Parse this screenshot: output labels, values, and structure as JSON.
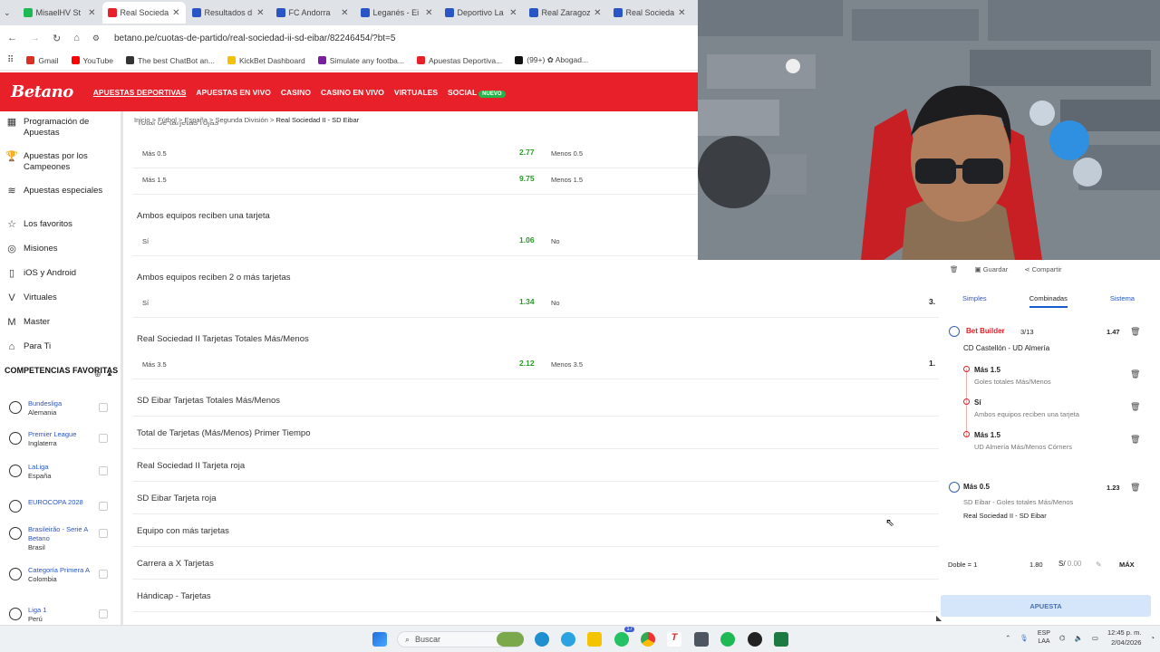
{
  "browser": {
    "tabs": [
      {
        "label": "MisaelHV St",
        "color": "#1db954",
        "active": false
      },
      {
        "label": "Real Socieda",
        "color": "#e8202a",
        "active": true
      },
      {
        "label": "Resultados d",
        "color": "#2a55c4",
        "active": false
      },
      {
        "label": "FC Andorra",
        "color": "#2a55c4",
        "active": false
      },
      {
        "label": "Leganés - Ei",
        "color": "#2a55c4",
        "active": false
      },
      {
        "label": "Deportivo La",
        "color": "#2a55c4",
        "active": false
      },
      {
        "label": "Real Zaragoz",
        "color": "#2a55c4",
        "active": false
      },
      {
        "label": "Real Socieda",
        "color": "#2a55c4",
        "active": false
      }
    ],
    "url": "betano.pe/cuotas-de-partido/real-sociedad-ii-sd-eibar/82246454/?bt=5",
    "bookmarks": [
      {
        "label": "Gmail",
        "color": "#d93025"
      },
      {
        "label": "YouTube",
        "color": "#ff0000"
      },
      {
        "label": "The best ChatBot an...",
        "color": "#333333"
      },
      {
        "label": "KickBet Dashboard",
        "color": "#f2c200"
      },
      {
        "label": "Simulate any footba...",
        "color": "#7b1fa2"
      },
      {
        "label": "Apuestas Deportiva...",
        "color": "#e8202a"
      },
      {
        "label": "(99+) ✿ Abogad...",
        "color": "#111111"
      }
    ]
  },
  "header": {
    "logo": "Betano",
    "nav": [
      "APUESTAS DEPORTIVAS",
      "APUESTAS EN VIVO",
      "CASINO",
      "CASINO EN VIVO",
      "VIRTUALES",
      "SOCIAL"
    ],
    "nav_badge": "NUEVO"
  },
  "sidebar": {
    "items": [
      {
        "label": "Programación de Apuestas",
        "icon": "calendar-icon"
      },
      {
        "label": "Apuestas por los Campeones",
        "icon": "trophy-icon"
      },
      {
        "label": "Apuestas especiales",
        "icon": "special-icon"
      },
      {
        "label": "Los favoritos",
        "icon": "star-icon"
      },
      {
        "label": "Misiones",
        "icon": "target-icon"
      },
      {
        "label": "iOS y Android",
        "icon": "phone-icon"
      },
      {
        "label": "Virtuales",
        "icon": "virtual-icon"
      },
      {
        "label": "Master",
        "icon": "master-icon"
      },
      {
        "label": "Para Ti",
        "icon": "foryou-icon"
      }
    ],
    "competitions_header": "COMPETENCIAS FAVORITAS",
    "competitions": [
      {
        "name": "Bundesliga",
        "country": "Alemania"
      },
      {
        "name": "Premier League",
        "country": "Inglaterra"
      },
      {
        "name": "LaLiga",
        "country": "España"
      },
      {
        "name": "EUROCOPA 2028",
        "country": ""
      },
      {
        "name": "Brasileirão - Serie A Betano",
        "country": "Brasil"
      },
      {
        "name": "Categoría Primera A",
        "country": "Colombia"
      },
      {
        "name": "Liga 1",
        "country": "Perú"
      }
    ]
  },
  "main": {
    "breadcrumb": [
      "Inicio",
      "Fútbol",
      "España",
      "Segunda División",
      "Real Sociedad II - SD Eibar"
    ],
    "cut_title": "Total de tarjetas rojas",
    "markets": [
      {
        "title": "",
        "rows": [
          {
            "left": "Más 0.5",
            "odd": "2.77",
            "right": "Menos 0.5"
          },
          {
            "left": "Más 1.5",
            "odd": "9.75",
            "right": "Menos 1.5"
          }
        ]
      },
      {
        "title": "Ambos equipos reciben una tarjeta",
        "rows": [
          {
            "left": "Sí",
            "odd": "1.06",
            "right": "No"
          }
        ]
      },
      {
        "title": "Ambos equipos reciben 2 o más tarjetas",
        "rows": [
          {
            "left": "Sí",
            "odd": "1.34",
            "right": "No",
            "right_odd_cut": "3."
          }
        ]
      },
      {
        "title": "Real Sociedad II Tarjetas Totales Más/Menos",
        "rows": [
          {
            "left": "Más 3.5",
            "odd": "2.12",
            "right": "Menos 3.5",
            "right_odd_cut": "1."
          }
        ]
      }
    ],
    "collapsed": [
      "SD Eibar Tarjetas Totales Más/Menos",
      "Total de Tarjetas (Más/Menos) Primer Tiempo",
      "Real Sociedad II Tarjeta roja",
      "SD Eibar Tarjeta roja",
      "Equipo con más tarjetas",
      "Carrera a X Tarjetas",
      "Hándicap - Tarjetas"
    ]
  },
  "betslip": {
    "guardar": "Guardar",
    "compartir": "Compartir",
    "tabs": [
      "Simples",
      "Combinadas",
      "Sistema"
    ],
    "active_tab": "Combinadas",
    "bb_title": "Bet Builder",
    "bb_count": "3/13",
    "bb_odd": "1.47",
    "bb_match": "CD Castellón - UD Almería",
    "picks": [
      {
        "sel": "Más 1.5",
        "market": "Goles totales Más/Menos"
      },
      {
        "sel": "Sí",
        "market": "Ambos equipos reciben una tarjeta"
      },
      {
        "sel": "Más 1.5",
        "market": "UD Almería Más/Menos Córners"
      }
    ],
    "single": {
      "sel": "Más 0.5",
      "odd": "1.23",
      "market": "SD Eibar - Goles totales Más/Menos",
      "match": "Real Sociedad II - SD Eibar"
    },
    "footer": {
      "label": "Doble = 1",
      "odd": "1.80",
      "stake_prefix": "S/",
      "stake": "0.00",
      "max": "MÁX"
    },
    "apuesta": "APUESTA"
  },
  "taskbar": {
    "search": "Buscar",
    "lang1": "ESP",
    "lang2": "LAA",
    "time": "12:45 p. m.",
    "date": "2/04/2026",
    "whatsapp_badge": "17"
  }
}
